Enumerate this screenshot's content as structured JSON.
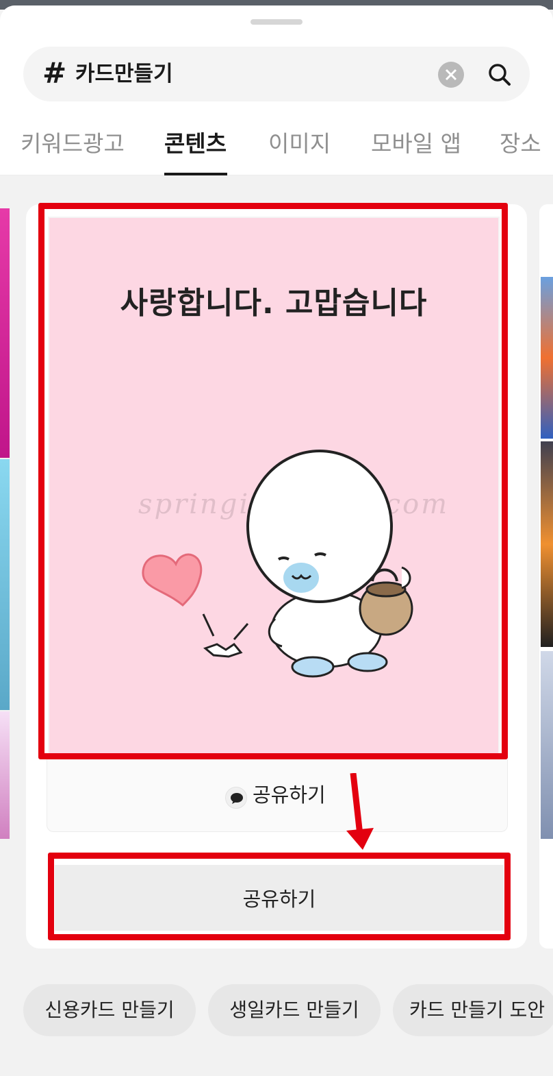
{
  "search": {
    "hash": "#",
    "query": "카드만들기"
  },
  "tabs": [
    {
      "label": "키워드광고",
      "active": false
    },
    {
      "label": "콘텐츠",
      "active": true
    },
    {
      "label": "이미지",
      "active": false
    },
    {
      "label": "모바일 앱",
      "active": false
    },
    {
      "label": "장소",
      "active": false
    }
  ],
  "card": {
    "message": "사랑합니다. 고맙습니다",
    "watermark": "springit.tistory.com",
    "share_inline_label": "공유하기",
    "share_button_label": "공유하기"
  },
  "related_chips": [
    "신용카드 만들기",
    "생일카드 만들기",
    "카드 만들기 도안"
  ],
  "colors": {
    "highlight": "#e3000f",
    "card_bg": "#fdd7e3",
    "accent_dark": "#1a1a1a"
  },
  "icons": {
    "clear": "close-circle-icon",
    "search": "search-icon",
    "share": "speech-bubble-icon"
  }
}
